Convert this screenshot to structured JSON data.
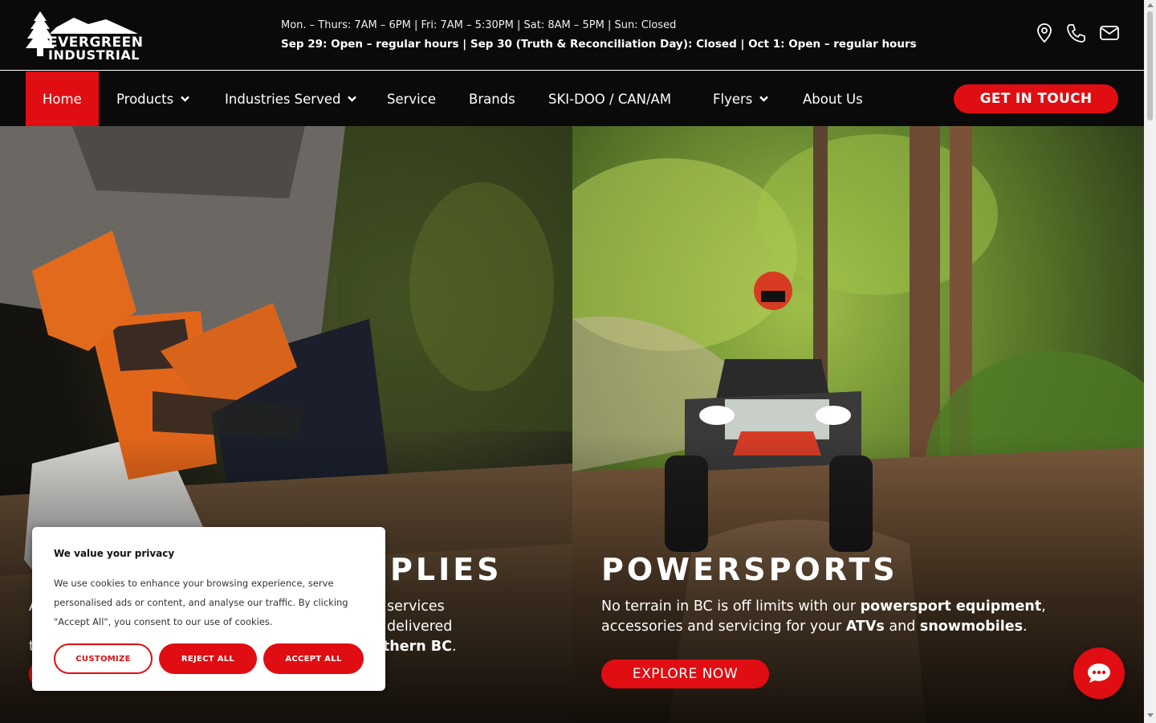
{
  "brand": {
    "name_line1": "EVERGREEN",
    "name_line2": "INDUSTRIAL"
  },
  "header": {
    "hours": "Mon. – Thurs: 7AM – 6PM | Fri: 7AM – 5:30PM | Sat: 8AM – 5PM | Sun: Closed",
    "notice": "Sep 29: Open – regular hours | Sep 30 (Truth & Reconciliation Day): Closed | Oct 1: Open – regular hours",
    "icons": [
      "location-icon",
      "phone-icon",
      "email-icon"
    ]
  },
  "nav": {
    "items": [
      {
        "label": "Home",
        "active": true
      },
      {
        "label": "Products",
        "dropdown": true
      },
      {
        "label": "Industries Served",
        "dropdown": true
      },
      {
        "label": "Service"
      },
      {
        "label": "Brands"
      },
      {
        "label": "SKI-DOO / CAN/AM"
      },
      {
        "label": "Flyers",
        "dropdown": true
      },
      {
        "label": "About Us"
      }
    ],
    "cta": "GET IN TOUCH"
  },
  "hero": {
    "left": {
      "title_visible": "PLIES",
      "desc_part1": "A",
      "desc_visible_mid": "services delivered",
      "desc_line2_start": "t",
      "desc_bold_end": "thern BC",
      "desc_line2_end": "."
    },
    "right": {
      "title": "POWERSPORTS",
      "desc_1": "No terrain in BC is off limits with our ",
      "desc_b1": "powersport equipment",
      "desc_2": ",",
      "desc_3": "accessories and servicing for your ",
      "desc_b2": "ATVs",
      "desc_4": " and ",
      "desc_b3": "snowmobiles",
      "desc_5": ".",
      "button": "EXPLORE NOW"
    }
  },
  "cookie": {
    "title": "We value your privacy",
    "body": "We use cookies to enhance your browsing experience, serve personalised ads or content, and analyse our traffic. By clicking \"Accept All\", you consent to our use of cookies.",
    "customize": "CUSTOMIZE",
    "reject": "REJECT ALL",
    "accept": "ACCEPT ALL"
  },
  "colors": {
    "accent": "#e00d12",
    "bar": "#0a0a0a"
  }
}
